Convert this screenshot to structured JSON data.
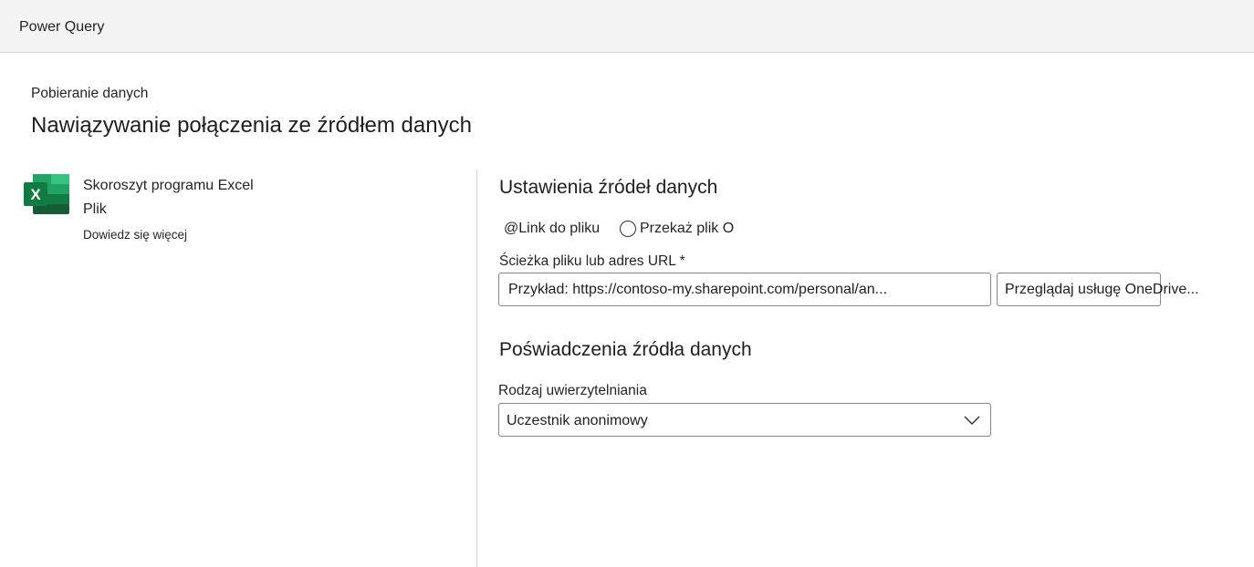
{
  "app": {
    "title": "Power Query"
  },
  "header": {
    "breadcrumb": "Pobieranie danych",
    "title": "Nawiązywanie połączenia ze źródłem danych"
  },
  "connector": {
    "icon": "excel-icon",
    "name": "Skoroszyt programu Excel",
    "category": "Plik",
    "learn_more": "Dowiedz się więcej"
  },
  "settings": {
    "title": "Ustawienia źródeł danych",
    "options": {
      "link_label": "@Link do pliku",
      "upload_label": "Przekaż plik O"
    },
    "path_label": "Ścieżka pliku lub adres URL *",
    "path_placeholder": "Przykład: https://contoso-my.sharepoint.com/personal/an...",
    "browse_label": "Przeglądaj usługę OneDrive..."
  },
  "credentials": {
    "title": "Poświadczenia źródła danych",
    "auth_label": "Rodzaj uwierzytelniania",
    "auth_value": "Uczestnik anonimowy"
  },
  "colors": {
    "titlebar_bg": "#f3f3f3",
    "excel_dark": "#185c37",
    "excel_mid": "#21a366",
    "excel_light": "#33c481"
  }
}
